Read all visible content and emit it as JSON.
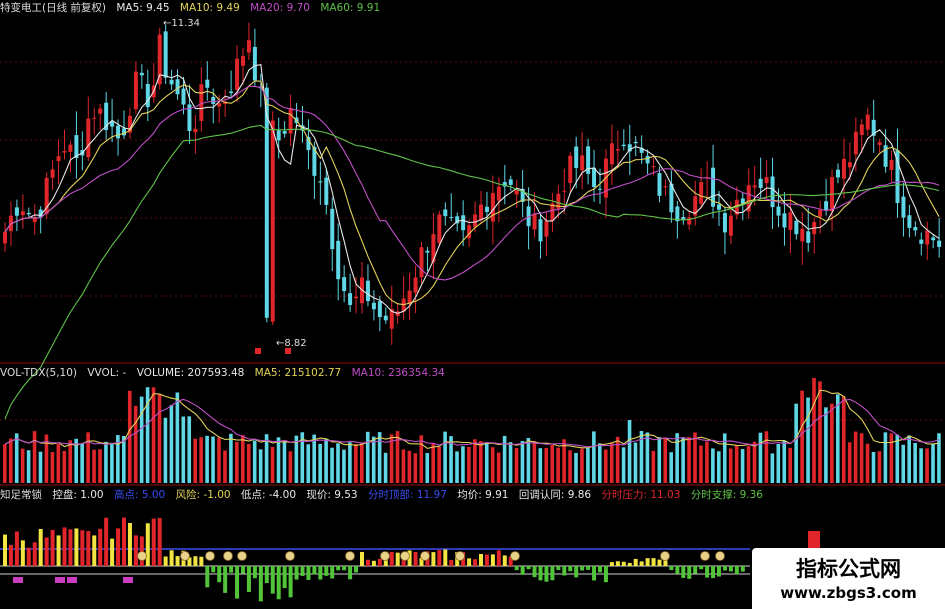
{
  "colors": {
    "up": "#e0262b",
    "down": "#5fd7e6",
    "ma5": "#e8e8e8",
    "ma10": "#e3d35c",
    "ma20": "#c04fc8",
    "ma60": "#5fc24a",
    "grid": "#5a0b0b",
    "yellowbar": "#f2e442",
    "greenbar": "#52c43a",
    "blueline": "#3a4ef0"
  },
  "price_header": {
    "title": "特变电工(日线 前复权)",
    "ma5": "MA5: 9.45",
    "ma10": "MA10: 9.49",
    "ma20": "MA20: 9.70",
    "ma60": "MA60: 9.91"
  },
  "vol_header": {
    "name": "VOL-TDX(5,10)",
    "vvol": "VVOL: -",
    "volume": "VOLUME: 207593.48",
    "ma5": "MA5: 215102.77",
    "ma10": "MA10: 236354.34"
  },
  "ind_header": {
    "name": "知足常锁",
    "kongpan": "控盘: 1.00",
    "gaodian": "高点: 5.00",
    "fengxian": "风险: -1.00",
    "didian": "低点: -4.00",
    "xianjia": "现价: 9.53",
    "fenshi_ding": "分时顶部: 11.97",
    "junjia": "均价: 9.91",
    "huitiao": "回调认同: 9.86",
    "yali": "分时压力: 11.03",
    "zhicheng": "分时支撑: 9.36"
  },
  "annotations": {
    "high": "11.34",
    "low": "8.82"
  },
  "watermark": {
    "line1": "指标公式网",
    "line2": "www.zbgs3.com"
  },
  "chart_data": [
    {
      "type": "candlestick",
      "title": "特变电工(日线 前复权)",
      "series": [
        {
          "name": "MA5",
          "last": 9.45
        },
        {
          "name": "MA10",
          "last": 9.49
        },
        {
          "name": "MA20",
          "last": 9.7
        },
        {
          "name": "MA60",
          "last": 9.91
        }
      ],
      "annotations": [
        {
          "label": "11.34",
          "kind": "high"
        },
        {
          "label": "8.82",
          "kind": "low"
        }
      ],
      "close_path": [
        9.6,
        9.9,
        9.7,
        10.0,
        10.4,
        10.2,
        10.7,
        10.6,
        10.4,
        10.9,
        10.8,
        11.1,
        10.8,
        10.5,
        10.9,
        10.7,
        11.0,
        11.34,
        10.6,
        10.4,
        10.7,
        10.3,
        10.1,
        9.4,
        8.9,
        9.1,
        8.85,
        8.82,
        9.1,
        9.4,
        9.7,
        9.6,
        9.5,
        9.8,
        10.0,
        10.1,
        9.8,
        9.6,
        9.8,
        10.1,
        10.2,
        10.0,
        10.2,
        10.5,
        10.3,
        10.1,
        9.9,
        9.8,
        9.9,
        10.0,
        9.7,
        9.9,
        10.1,
        10.0,
        9.8,
        9.7,
        9.6,
        9.9,
        10.1,
        10.3,
        10.6,
        10.4,
        10.0,
        9.7,
        9.6,
        9.5
      ]
    },
    {
      "type": "bar",
      "title": "VOL-TDX(5,10)",
      "series": [
        {
          "name": "VOLUME",
          "last": 207593.48
        },
        {
          "name": "MA5",
          "last": 215102.77
        },
        {
          "name": "MA10",
          "last": 236354.34
        }
      ]
    },
    {
      "type": "bar",
      "title": "知足常锁",
      "series": [
        {
          "name": "控盘",
          "last": 1.0
        },
        {
          "name": "高点",
          "last": 5.0
        },
        {
          "name": "风险",
          "last": -1.0
        },
        {
          "name": "低点",
          "last": -4.0
        }
      ]
    }
  ]
}
